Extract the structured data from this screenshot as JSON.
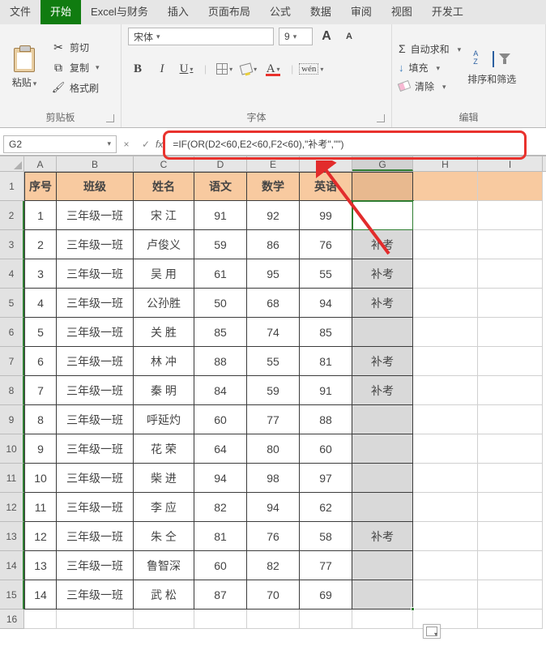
{
  "tabs": [
    "文件",
    "开始",
    "Excel与财务",
    "插入",
    "页面布局",
    "公式",
    "数据",
    "审阅",
    "视图",
    "开发工"
  ],
  "active_tab_index": 1,
  "ribbon": {
    "clipboard": {
      "label": "剪贴板",
      "paste": "粘贴",
      "cut": "剪切",
      "copy": "复制",
      "format_painter": "格式刷"
    },
    "font": {
      "label": "字体",
      "font_name": "宋体",
      "font_size": "9",
      "increase": "A",
      "decrease": "A",
      "bold": "B",
      "italic": "I",
      "underline": "U",
      "font_color_char": "A",
      "wen": "wén"
    },
    "editing": {
      "label": "编辑",
      "autosum": "自动求和",
      "fill": "填充",
      "clear": "清除",
      "sort_filter": "排序和筛选"
    }
  },
  "name_box": "G2",
  "formula": "=IF(OR(D2<60,E2<60,F2<60),\"补考\",\"\")",
  "columns": [
    "A",
    "B",
    "C",
    "D",
    "E",
    "F",
    "G",
    "H",
    "I"
  ],
  "col_widths_class": [
    "w-a",
    "w-b",
    "w-c",
    "w-d",
    "w-e",
    "w-f",
    "w-g",
    "w-h",
    "w-i"
  ],
  "headers": [
    "序号",
    "班级",
    "姓名",
    "语文",
    "数学",
    "英语",
    ""
  ],
  "rows": [
    {
      "no": "1",
      "class": "三年级一班",
      "name": "宋   江",
      "yw": "91",
      "sx": "92",
      "yy": "99",
      "g": ""
    },
    {
      "no": "2",
      "class": "三年级一班",
      "name": "卢俊义",
      "yw": "59",
      "sx": "86",
      "yy": "76",
      "g": "补考"
    },
    {
      "no": "3",
      "class": "三年级一班",
      "name": "吴   用",
      "yw": "61",
      "sx": "95",
      "yy": "55",
      "g": "补考"
    },
    {
      "no": "4",
      "class": "三年级一班",
      "name": "公孙胜",
      "yw": "50",
      "sx": "68",
      "yy": "94",
      "g": "补考"
    },
    {
      "no": "5",
      "class": "三年级一班",
      "name": "关   胜",
      "yw": "85",
      "sx": "74",
      "yy": "85",
      "g": ""
    },
    {
      "no": "6",
      "class": "三年级一班",
      "name": "林   冲",
      "yw": "88",
      "sx": "55",
      "yy": "81",
      "g": "补考"
    },
    {
      "no": "7",
      "class": "三年级一班",
      "name": "秦   明",
      "yw": "84",
      "sx": "59",
      "yy": "91",
      "g": "补考"
    },
    {
      "no": "8",
      "class": "三年级一班",
      "name": "呼延灼",
      "yw": "60",
      "sx": "77",
      "yy": "88",
      "g": ""
    },
    {
      "no": "9",
      "class": "三年级一班",
      "name": "花   荣",
      "yw": "64",
      "sx": "80",
      "yy": "60",
      "g": ""
    },
    {
      "no": "10",
      "class": "三年级一班",
      "name": "柴   进",
      "yw": "94",
      "sx": "98",
      "yy": "97",
      "g": ""
    },
    {
      "no": "11",
      "class": "三年级一班",
      "name": "李   应",
      "yw": "82",
      "sx": "94",
      "yy": "62",
      "g": ""
    },
    {
      "no": "12",
      "class": "三年级一班",
      "name": "朱   仝",
      "yw": "81",
      "sx": "76",
      "yy": "58",
      "g": "补考"
    },
    {
      "no": "13",
      "class": "三年级一班",
      "name": "鲁智深",
      "yw": "60",
      "sx": "82",
      "yy": "77",
      "g": ""
    },
    {
      "no": "14",
      "class": "三年级一班",
      "name": "武   松",
      "yw": "87",
      "sx": "70",
      "yy": "69",
      "g": ""
    }
  ],
  "extra_row_label": "16",
  "selected_col_index": 6,
  "active_row_index": 0
}
